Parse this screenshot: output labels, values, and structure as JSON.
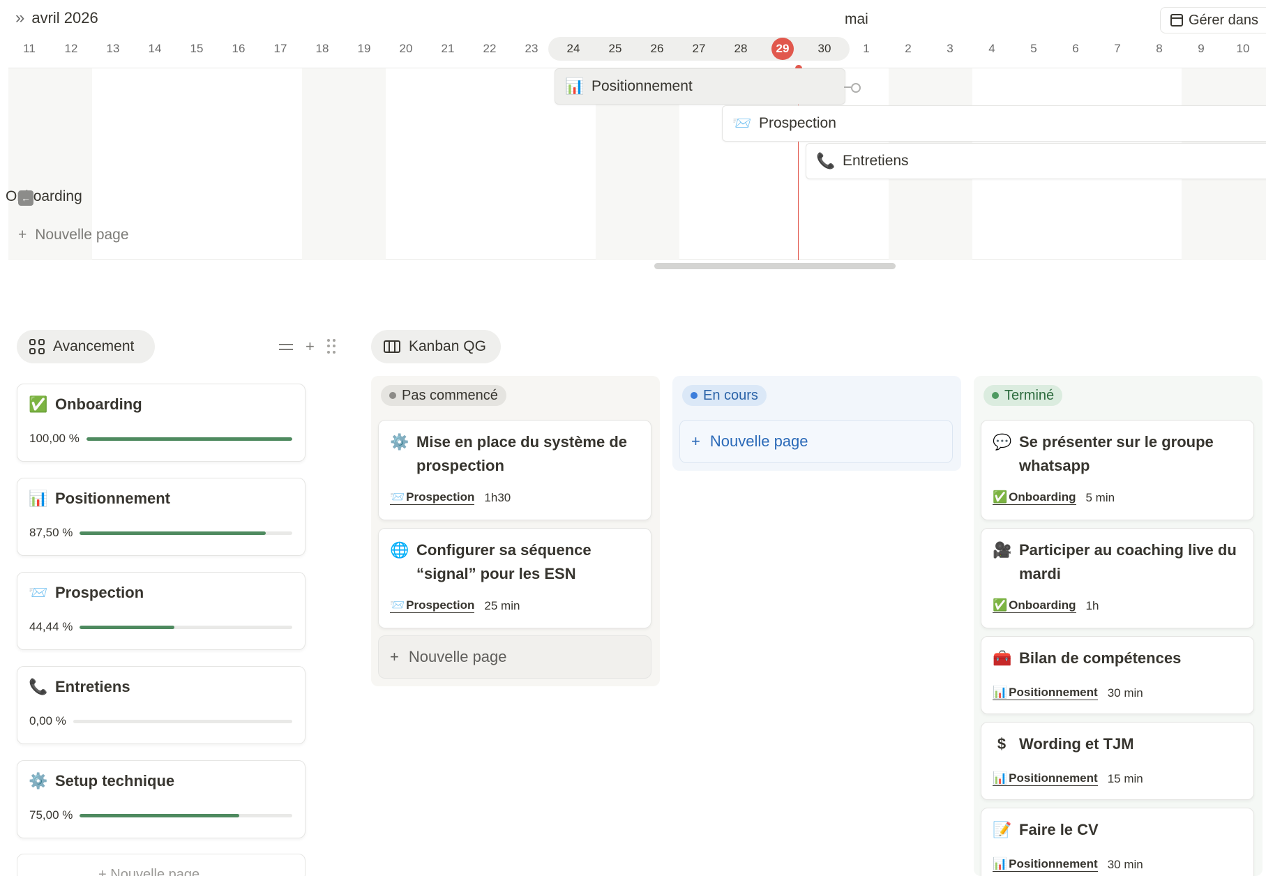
{
  "timeline": {
    "month_left": "avril 2026",
    "month_right": "mai",
    "manage_label": "Gérer dans",
    "days": [
      "11",
      "12",
      "13",
      "14",
      "15",
      "16",
      "17",
      "18",
      "19",
      "20",
      "21",
      "22",
      "23",
      "24",
      "25",
      "26",
      "27",
      "28",
      "29",
      "30",
      "1",
      "2",
      "3",
      "4",
      "5",
      "6",
      "7",
      "8",
      "9",
      "10"
    ],
    "today": "29",
    "bars": [
      {
        "icon": "📊",
        "label": "Positionnement"
      },
      {
        "icon": "📨",
        "label": "Prospection"
      },
      {
        "icon": "📞",
        "label": "Entretiens"
      },
      {
        "icon": "",
        "label": "Onboarding"
      }
    ],
    "new_page": "Nouvelle page"
  },
  "avancement": {
    "view_label": "Avancement",
    "items": [
      {
        "icon": "✅",
        "title": "Onboarding",
        "percent_label": "100,00 %",
        "percent": 100
      },
      {
        "icon": "📊",
        "title": "Positionnement",
        "percent_label": "87,50 %",
        "percent": 87.5
      },
      {
        "icon": "📨",
        "title": "Prospection",
        "percent_label": "44,44 %",
        "percent": 44.44
      },
      {
        "icon": "📞",
        "title": "Entretiens",
        "percent_label": "0,00 %",
        "percent": 0
      },
      {
        "icon": "⚙️",
        "title": "Setup technique",
        "percent_label": "75,00 %",
        "percent": 75
      }
    ],
    "new_page": "Nouvelle page"
  },
  "kanban": {
    "view_label": "Kanban QG",
    "columns": [
      {
        "status": "Pas commencé",
        "cards": [
          {
            "icon": "⚙️",
            "title": "Mise en place du système de prospection",
            "rel_icon": "📨",
            "rel": "Prospection",
            "time": "1h30"
          },
          {
            "icon": "🌐",
            "title": "Configurer sa séquence “signal” pour les ESN",
            "rel_icon": "📨",
            "rel": "Prospection",
            "time": "25 min"
          }
        ],
        "new_page": "Nouvelle page"
      },
      {
        "status": "En cours",
        "cards": [],
        "new_page": "Nouvelle page"
      },
      {
        "status": "Terminé",
        "cards": [
          {
            "icon": "💬",
            "title": "Se présenter sur le groupe whatsapp",
            "rel_icon": "✅",
            "rel": "Onboarding",
            "time": "5 min"
          },
          {
            "icon": "🎥",
            "title": "Participer au coaching live du mardi",
            "rel_icon": "✅",
            "rel": "Onboarding",
            "time": "1h"
          },
          {
            "icon": "🧰",
            "title": "Bilan de compétences",
            "rel_icon": "📊",
            "rel": "Positionnement",
            "time": "30 min"
          },
          {
            "icon": "$",
            "title": "Wording et TJM",
            "rel_icon": "📊",
            "rel": "Positionnement",
            "time": "15 min"
          },
          {
            "icon": "📝",
            "title": "Faire le CV",
            "rel_icon": "📊",
            "rel": "Positionnement",
            "time": "30 min"
          }
        ]
      }
    ]
  },
  "colors": {
    "accent_red": "#e1584d",
    "progress_green": "#4e8a5f",
    "link_blue": "#2b6ab8"
  }
}
